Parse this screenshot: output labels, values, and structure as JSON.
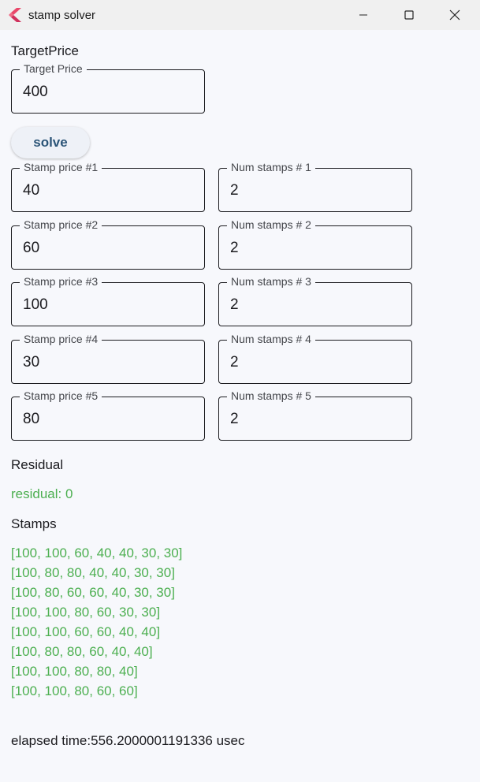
{
  "window": {
    "title": "stamp solver",
    "icon": "flutter-logo-icon"
  },
  "target": {
    "section_label": "TargetPrice",
    "field_label": "Target Price",
    "value": "400"
  },
  "solve_button": {
    "label": "solve"
  },
  "stamps_inputs": [
    {
      "price_label": "Stamp price #1",
      "price": "40",
      "count_label": "Num stamps # 1",
      "count": "2"
    },
    {
      "price_label": "Stamp price #2",
      "price": "60",
      "count_label": "Num stamps # 2",
      "count": "2"
    },
    {
      "price_label": "Stamp price #3",
      "price": "100",
      "count_label": "Num stamps # 3",
      "count": "2"
    },
    {
      "price_label": "Stamp price #4",
      "price": "30",
      "count_label": "Num stamps # 4",
      "count": "2"
    },
    {
      "price_label": "Stamp price #5",
      "price": "80",
      "count_label": "Num stamps # 5",
      "count": "2"
    }
  ],
  "residual": {
    "section_label": "Residual",
    "text": "residual: 0"
  },
  "stamps_results": {
    "section_label": "Stamps",
    "lines": [
      "[100, 100, 60, 40, 40, 30, 30]",
      "[100, 80, 80, 40, 40, 30, 30]",
      "[100, 80, 60, 60, 40, 30, 30]",
      "[100, 100, 80, 60, 30, 30]",
      "[100, 100, 60, 60, 40, 40]",
      "[100, 80, 80, 60, 40, 40]",
      "[100, 100, 80, 80, 40]",
      "[100, 100, 80, 60, 60]"
    ]
  },
  "elapsed": "elapsed time:556.2000001191336 usec",
  "colors": {
    "result_green": "#4caf50",
    "button_text": "#2c5578",
    "background": "#f7f8fc"
  }
}
